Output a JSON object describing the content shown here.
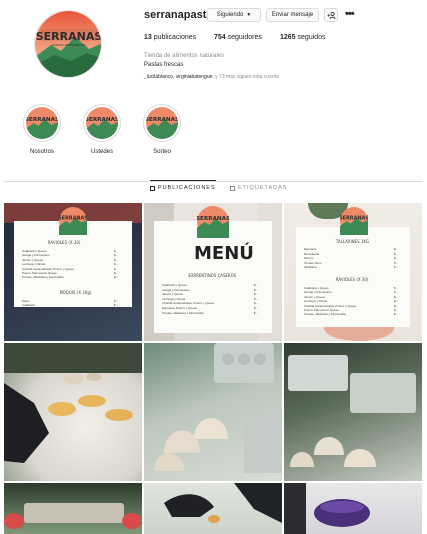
{
  "profile": {
    "username": "serranapastas",
    "follow_button": "Siguiendo",
    "message_button": "Enviar mensaje",
    "add_user_icon": "+👤",
    "more_icon": "•••",
    "stats": {
      "posts_count": "13",
      "posts_label": "publicaciones",
      "followers_count": "754",
      "followers_label": "seguidores",
      "following_count": "1265",
      "following_label": "seguidos"
    },
    "category": "Tienda de alimentos naturales",
    "bio": "Pastas frescas",
    "followed_by_names": "_lucilablanco, virginiabatengue",
    "followed_by_rest": ", y 73 más siguen esta cuenta",
    "logo_text": "SERRANAS"
  },
  "highlights": [
    {
      "label": "Nosotros"
    },
    {
      "label": "Ustedes"
    },
    {
      "label": "Sorteo"
    }
  ],
  "tabs": {
    "posts": "PUBLICACIONES",
    "tagged": "ETIQUETADAS"
  },
  "menu_posts": {
    "menu_title": "MENÚ",
    "sorrentinos_header": "SORRENTINOS CASEROS",
    "ravioles_header": "RAVIOLES (X 30)",
    "noquis_header": "ÑOQUIS (X 1Kg)",
    "tallarines_header": "TALLARINES 1KG",
    "ravioles2_header": "RAVIOLES (X 30)",
    "ravioles_items": [
      "Calabaza y Queso",
      "Acelga y Parmesano",
      "Jamón y Queso",
      "Lechuga y Ricota",
      "Cebolla Caramelizada, Puerro y Queso",
      "Puerro Parmesano Queso",
      "Tomate, Albahaca y Mozzarella"
    ],
    "noquis_items": [
      "Papa",
      "Calabaza",
      "Espinaca",
      "Remolacha"
    ],
    "sorrentinos_items": [
      "Calabaza y Queso",
      "Acelga y Parmesano",
      "Jamón y Queso",
      "Lechuga y Ricota",
      "Cebolla Caramelizada, Puerro y Queso",
      "Espinaca, Puerro y Queso",
      "Tomate, Albahaca y Mozzarella"
    ],
    "tallarines_items": [
      "Espinaca",
      "Remolacha",
      "Morrón",
      "Tomate Seco",
      "Albahaca"
    ],
    "ravioles2_items": [
      "Calabaza y Queso",
      "Acelga y Parmesano",
      "Jamón y Queso",
      "Lechuga y Ricota",
      "Cebolla Caramelizada, Puerro y Queso",
      "Puerro Parmesano Queso",
      "Tomate, Albahaca y Mozzarella"
    ],
    "price_placeholder": "$..."
  },
  "colors": {
    "text": "#262626",
    "muted": "#8e8e8e",
    "border": "#dbdbdb",
    "logo_orange": "#e85a3c",
    "logo_green": "#2f7d4a",
    "logo_pink": "#f2a58e"
  }
}
